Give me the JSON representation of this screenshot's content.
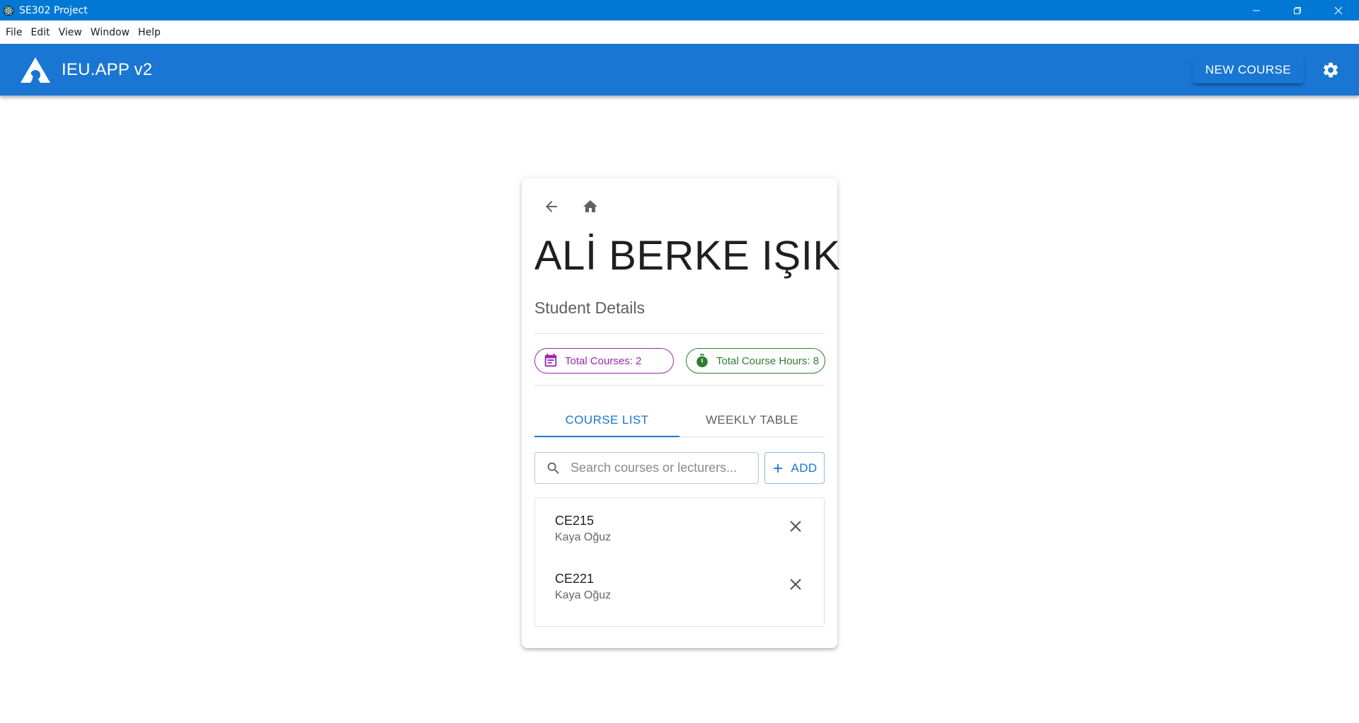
{
  "window": {
    "title": "SE302 Project",
    "controls": {
      "minimize_icon": "minimize-icon",
      "restore_icon": "restore-icon",
      "close_icon": "close-icon"
    }
  },
  "menu": {
    "items": [
      "File",
      "Edit",
      "View",
      "Window",
      "Help"
    ]
  },
  "appbar": {
    "brand": "IEU.APP v2",
    "new_course_label": "NEW COURSE",
    "color": "#1976d2"
  },
  "student": {
    "name": "ALİ BERKE IŞIK",
    "subtitle": "Student Details",
    "total_courses": "Total Courses: 2",
    "total_hours": "Total Course Hours: 8"
  },
  "tabs": [
    {
      "label": "COURSE LIST",
      "active": true
    },
    {
      "label": "WEEKLY TABLE",
      "active": false
    }
  ],
  "search": {
    "placeholder": "Search courses or lecturers...",
    "value": ""
  },
  "add_label": "ADD",
  "courses": [
    {
      "code": "CE215",
      "lecturer": "Kaya Oğuz"
    },
    {
      "code": "CE221",
      "lecturer": "Kaya Oğuz"
    }
  ],
  "colors": {
    "primary": "#1976d2",
    "titlebar": "#0078d4",
    "chip_courses": "#9c27b0",
    "chip_hours": "#2e7d32"
  }
}
